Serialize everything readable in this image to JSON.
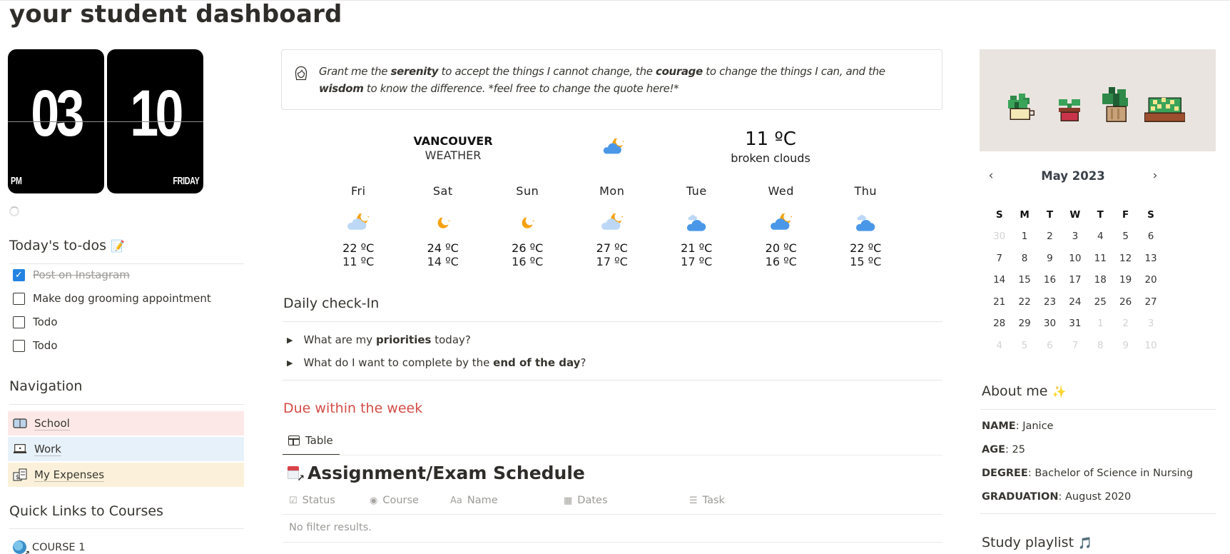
{
  "page": {
    "title": "your student dashboard"
  },
  "clock": {
    "hour": "03",
    "minute": "10",
    "meridiem": "PM",
    "weekday": "FRIDAY"
  },
  "todos": {
    "heading": "Today's to-dos",
    "heading_emoji": "📝",
    "items": [
      {
        "label": "Post on Instagram",
        "checked": true
      },
      {
        "label": "Make dog grooming appointment",
        "checked": false
      },
      {
        "label": "Todo",
        "checked": false
      },
      {
        "label": "Todo",
        "checked": false
      }
    ]
  },
  "navigation": {
    "heading": "Navigation",
    "items": [
      {
        "label": "School",
        "icon": "book-icon",
        "bg": "#fde8e8"
      },
      {
        "label": "Work",
        "icon": "laptop-icon",
        "bg": "#e7f1fa"
      },
      {
        "label": "My Expenses",
        "icon": "money-icon",
        "bg": "#fbf1da"
      }
    ]
  },
  "courses": {
    "heading": "Quick Links to Courses",
    "items": [
      {
        "label": "COURSE 1",
        "icon": "globe-link-icon"
      }
    ]
  },
  "quote": {
    "parts": [
      {
        "t": "Grant me the ",
        "b": false
      },
      {
        "t": "serenity",
        "b": true
      },
      {
        "t": " to accept the things I cannot change, the ",
        "b": false
      },
      {
        "t": "courage",
        "b": true
      },
      {
        "t": " to change the things I can, and the ",
        "b": false
      },
      {
        "t": "wisdom",
        "b": true
      },
      {
        "t": " to know the difference. *feel free to change the quote here!*",
        "b": false
      }
    ]
  },
  "weather": {
    "city": "VANCOUVER",
    "label": "WEATHER",
    "current_temp": "11 ºC",
    "current_desc": "broken clouds",
    "current_icon": "cloud-moon",
    "forecast": [
      {
        "day": "Fri",
        "icon": "cloud-moon-light",
        "high": "22 ºC",
        "low": "11 ºC"
      },
      {
        "day": "Sat",
        "icon": "moon",
        "high": "24 ºC",
        "low": "14 ºC"
      },
      {
        "day": "Sun",
        "icon": "moon",
        "high": "26 ºC",
        "low": "16 ºC"
      },
      {
        "day": "Mon",
        "icon": "cloud-moon-light",
        "high": "27 ºC",
        "low": "17 ºC"
      },
      {
        "day": "Tue",
        "icon": "clouds",
        "high": "21 ºC",
        "low": "17 ºC"
      },
      {
        "day": "Wed",
        "icon": "cloud-moon",
        "high": "20 ºC",
        "low": "16 ºC"
      },
      {
        "day": "Thu",
        "icon": "clouds",
        "high": "22 ºC",
        "low": "15 ºC"
      }
    ]
  },
  "checkin": {
    "heading": "Daily check-In",
    "toggles": [
      {
        "pre": "What are my ",
        "bold": "priorities",
        "post": " today?"
      },
      {
        "pre": "What do I want to complete by the ",
        "bold": "end of the day",
        "post": "?"
      }
    ]
  },
  "due": {
    "heading": "Due within the week",
    "view_tab": "Table",
    "db_title": "Assignment/Exam Schedule",
    "columns": [
      {
        "label": "Status",
        "icon": "☑"
      },
      {
        "label": "Course",
        "icon": "◉"
      },
      {
        "label": "Name",
        "icon": "Aa"
      },
      {
        "label": "Dates",
        "icon": "▦"
      },
      {
        "label": "Task",
        "icon": "☰"
      }
    ],
    "empty_text": "No filter results."
  },
  "calendar": {
    "month_label": "May 2023",
    "prev": "‹",
    "next": "›",
    "weekdays": [
      "S",
      "M",
      "T",
      "W",
      "T",
      "F",
      "S"
    ],
    "days": [
      [
        "30",
        1
      ],
      [
        "1",
        0
      ],
      [
        "2",
        0
      ],
      [
        "3",
        0
      ],
      [
        "4",
        0
      ],
      [
        "5",
        0
      ],
      [
        "6",
        0
      ],
      [
        "7",
        0
      ],
      [
        "8",
        0
      ],
      [
        "9",
        0
      ],
      [
        "10",
        0
      ],
      [
        "11",
        0
      ],
      [
        "12",
        0
      ],
      [
        "13",
        0
      ],
      [
        "14",
        0
      ],
      [
        "15",
        0
      ],
      [
        "16",
        0
      ],
      [
        "17",
        0
      ],
      [
        "18",
        0
      ],
      [
        "19",
        0
      ],
      [
        "20",
        0
      ],
      [
        "21",
        0
      ],
      [
        "22",
        0
      ],
      [
        "23",
        0
      ],
      [
        "24",
        0
      ],
      [
        "25",
        0
      ],
      [
        "26",
        0
      ],
      [
        "27",
        0
      ],
      [
        "28",
        0
      ],
      [
        "29",
        0
      ],
      [
        "30",
        0
      ],
      [
        "31",
        0
      ],
      [
        "1",
        1
      ],
      [
        "2",
        1
      ],
      [
        "3",
        1
      ],
      [
        "4",
        1
      ],
      [
        "5",
        1
      ],
      [
        "6",
        1
      ],
      [
        "7",
        1
      ],
      [
        "8",
        1
      ],
      [
        "9",
        1
      ],
      [
        "10",
        1
      ]
    ]
  },
  "about": {
    "heading": "About me",
    "heading_emoji": "✨",
    "rows": [
      {
        "key": "NAME",
        "value": "Janice"
      },
      {
        "key": "AGE",
        "value": "25"
      },
      {
        "key": "DEGREE",
        "value": "Bachelor of Science in Nursing"
      },
      {
        "key": "GRADUATION",
        "value": "August 2020"
      }
    ]
  },
  "playlist": {
    "heading": "Study playlist",
    "heading_emoji": "🎵"
  }
}
